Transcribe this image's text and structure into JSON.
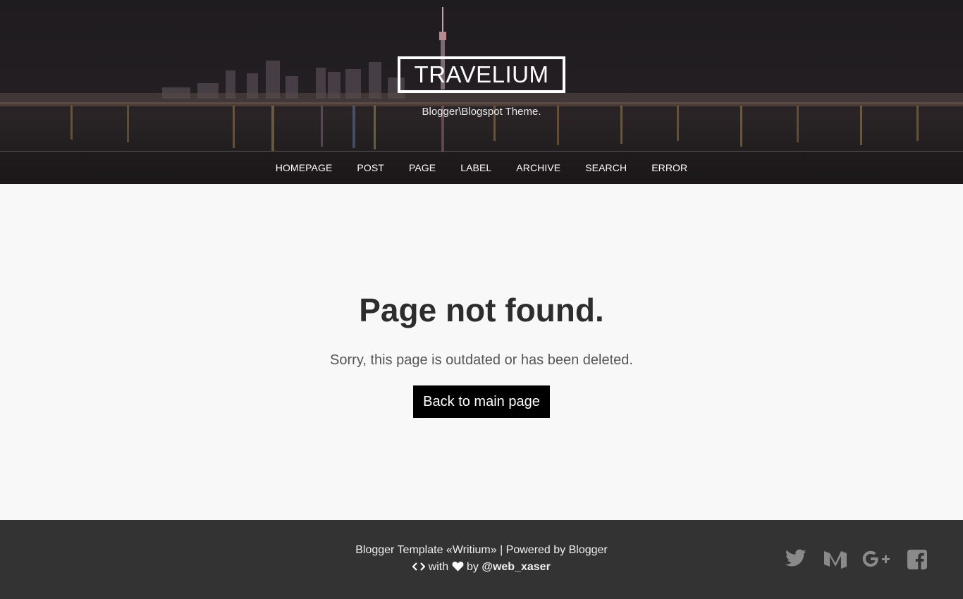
{
  "header": {
    "site_title": "TRAVELIUM",
    "tagline": "Blogger\\Blogspot Theme.",
    "nav": [
      "HOMEPAGE",
      "POST",
      "PAGE",
      "LABEL",
      "ARCHIVE",
      "SEARCH",
      "ERROR"
    ]
  },
  "main": {
    "title": "Page not found.",
    "message": "Sorry, this page is outdated or has been deleted.",
    "back_button": "Back to main page"
  },
  "footer": {
    "line1": "Blogger Template «Writium» | Powered by Blogger",
    "with_text": "with",
    "by_text": "by",
    "author": "@web_xaser",
    "social": [
      "twitter-icon",
      "medium-icon",
      "google-plus-icon",
      "facebook-icon"
    ]
  },
  "colors": {
    "button_bg": "#000000",
    "footer_bg": "#333333",
    "page_bg": "#f8f8f8",
    "social_icon": "#8a8a8a"
  }
}
